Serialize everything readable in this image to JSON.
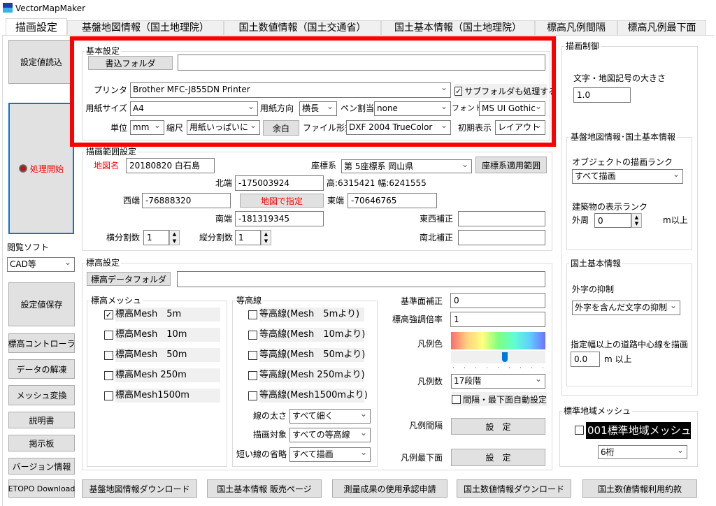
{
  "window": {
    "title": "VectorMapMaker",
    "icon": "app-icon"
  },
  "tabs": [
    "描画設定",
    "基盤地図情報（国土地理院）",
    "国土数値情報（国土交通省）",
    "国土基本情報（国土地理院）",
    "標高凡例間隔",
    "標高凡例最下面"
  ],
  "left": {
    "load": "設定値読込",
    "start": "処理開始",
    "viewer_label": "閲覧ソフト",
    "viewer_value": "CAD等",
    "save": "設定値保存",
    "buttons": [
      "標高コントローラ",
      "データの解凍",
      "メッシュ変換",
      "説明書",
      "掲示板",
      "バージョン情報"
    ],
    "etopo": "ETOPO Download"
  },
  "basic": {
    "title": "基本設定",
    "folder_btn": "書込フォルダ",
    "folder_value": "",
    "printer_label": "プリンタ",
    "printer": "Brother MFC-J855DN Printer",
    "subfolder": "サブフォルダも処理する",
    "subfolder_checked": true,
    "paper_label": "用紙サイズ",
    "paper": "A4",
    "orient_label": "用紙方向",
    "orient": "横長",
    "pen_label": "ペン割当",
    "pen": "none",
    "font_label": "フォント",
    "font": "MS UI Gothic",
    "unit_label": "単位",
    "unit": "mm",
    "scale_label": "縮尺",
    "scale": "用紙いっぱいに",
    "margin_btn": "余白",
    "format_label": "ファイル形式",
    "format": "DXF 2004 TrueColor",
    "initial_label": "初期表示",
    "initial": "レイアウト"
  },
  "range": {
    "title": "描画範囲設定",
    "name_label": "地図名",
    "name": "20180820 白石島",
    "crs_label": "座標系",
    "crs": "第 5座標系 岡山県",
    "crs_btn": "座標系適用範囲",
    "north_label": "北端",
    "north": "-175003924",
    "size_text": "高:6315421 幅:6241555",
    "west_label": "西端",
    "west": "-76888320",
    "map_btn": "地図で指定",
    "east_label": "東端",
    "east": "-70646765",
    "south_label": "南端",
    "south": "-181319345",
    "ew_label": "東西補正",
    "ew": "",
    "hdiv_label": "横分割数",
    "hdiv": "1",
    "vdiv_label": "縦分割数",
    "vdiv": "1",
    "ns_label": "南北補正",
    "ns": ""
  },
  "elev": {
    "title": "標高設定",
    "folder_btn": "標高データフォルダ",
    "folder_value": "",
    "mesh_title": "標高メッシュ",
    "mesh": [
      {
        "label": "標高Mesh　5m",
        "checked": true
      },
      {
        "label": "標高Mesh　10m",
        "checked": false
      },
      {
        "label": "標高Mesh　50m",
        "checked": false
      },
      {
        "label": "標高Mesh 250m",
        "checked": false
      },
      {
        "label": "標高Mesh1500m",
        "checked": false
      }
    ],
    "contour_title": "等高線",
    "contour": [
      {
        "label": "等高線(Mesh　5mより)",
        "checked": false
      },
      {
        "label": "等高線(Mesh　10mより)",
        "checked": false
      },
      {
        "label": "等高線(Mesh　50mより)",
        "checked": false
      },
      {
        "label": "等高線(Mesh 250mより)",
        "checked": false
      },
      {
        "label": "等高線(Mesh1500mより)",
        "checked": false
      }
    ],
    "width_label": "線の太さ",
    "width": "すべて細く",
    "target_label": "描画対象",
    "target": "すべての等高線",
    "short_label": "短い線の省略",
    "short": "すべて描画",
    "base_label": "基準面補正",
    "base": "0",
    "exag_label": "標高強調倍率",
    "exag": "1",
    "color_label": "凡例色",
    "color_slider_percent": 57,
    "count_label": "凡例数",
    "count": "17段階",
    "auto": "間隔・最下面自動設定",
    "auto_checked": false,
    "interval_label": "凡例間隔",
    "interval_btn": "設　定",
    "bottom_label": "凡例最下面",
    "bottom_btn": "設　定"
  },
  "control": {
    "title": "描画制御",
    "size_label": "文字・地図記号の大きさ",
    "size": "1.0",
    "sub1_title": "基盤地図情報･国土基本情報",
    "rank_label": "オブジェクトの描画ランク",
    "rank": "すべて描画",
    "bld_label": "建築物の表示ランク",
    "outer_label": "外周",
    "outer": "0",
    "outer_unit": "m以上",
    "sub2_title": "国土基本情報",
    "gaiji_label": "外字の抑制",
    "gaiji": "外字を含んだ文字の抑制",
    "road_label": "指定幅以上の道路中心線を描画",
    "road": "0.0",
    "road_unit": "m 以上"
  },
  "mesh_std": {
    "title": "標準地域メッシュ",
    "item": "001標準地域メッシュ",
    "checked": false,
    "digits": "6桁"
  },
  "bottom": [
    "基盤地図情報ダウンロード",
    "国土基本情報 販売ページ",
    "測量成果の使用承認申請",
    "国土数値情報ダウンロード",
    "国土数値情報利用約款"
  ],
  "colors": {
    "highlight": "#ff0000",
    "focus": "#0078d7",
    "required_label": "#ff0000"
  }
}
